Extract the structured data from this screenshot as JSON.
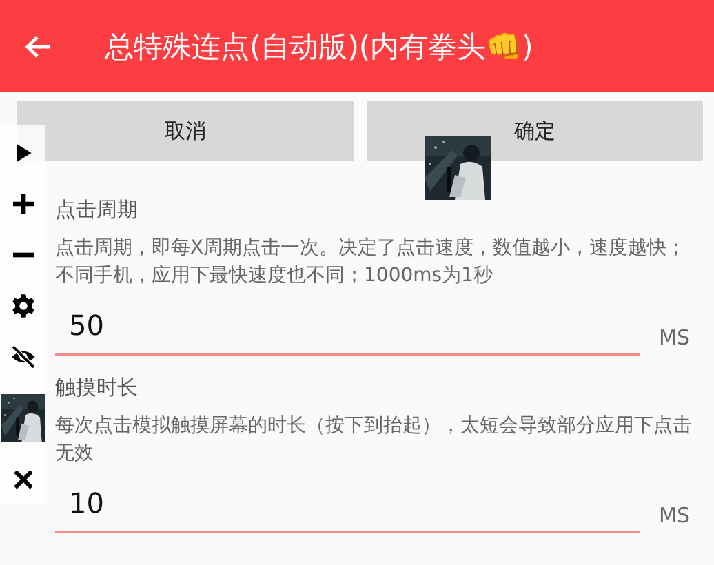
{
  "header": {
    "title": "总特殊连点(自动版)(内有拳头👊)"
  },
  "buttons": [
    {
      "label": "取消"
    },
    {
      "label": "确定"
    }
  ],
  "fields": [
    {
      "label": "点击周期",
      "description": "点击周期，即每X周期点击一次。决定了点击速度，数值越小，速度越快；不同手机，应用下最快速度也不同；1000ms为1秒",
      "value": "50",
      "unit": "MS"
    },
    {
      "label": "触摸时长",
      "description": "每次点击模拟触摸屏幕的时长（按下到抬起），太短会导致部分应用下点击无效",
      "value": "10",
      "unit": "MS"
    }
  ],
  "floating_toolbar": {
    "items": [
      {
        "kind": "play"
      },
      {
        "kind": "plus"
      },
      {
        "kind": "minus"
      },
      {
        "kind": "settings"
      },
      {
        "kind": "hide"
      },
      {
        "kind": "picture"
      },
      {
        "kind": "close"
      }
    ]
  },
  "preview": {
    "kind": "picture"
  }
}
